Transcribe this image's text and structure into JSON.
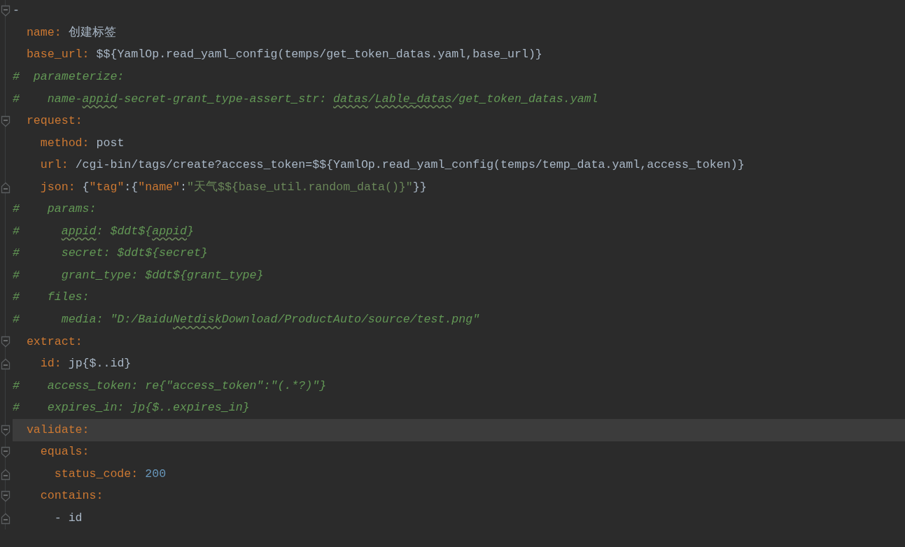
{
  "editor": {
    "lines": [
      {
        "kind": "fold_start",
        "current": false,
        "tokens": [
          {
            "kind": "plain",
            "text": "-"
          }
        ]
      },
      {
        "kind": "plain",
        "current": false,
        "tokens": [
          {
            "kind": "key",
            "text": "  name"
          },
          {
            "kind": "punct",
            "text": ": "
          },
          {
            "kind": "plain",
            "text": "创建标签"
          }
        ]
      },
      {
        "kind": "plain",
        "current": false,
        "tokens": [
          {
            "kind": "key",
            "text": "  base_url"
          },
          {
            "kind": "punct",
            "text": ": "
          },
          {
            "kind": "plain",
            "text": "$${YamlOp.read_yaml_config(temps/get_token_datas.yaml,base_url)}"
          }
        ]
      },
      {
        "kind": "plain",
        "current": false,
        "tokens": [
          {
            "kind": "comment",
            "text": "#  parameterize:"
          }
        ]
      },
      {
        "kind": "plain",
        "current": false,
        "tokens": [
          {
            "kind": "comment",
            "text": "#    name-"
          },
          {
            "kind": "comment",
            "text": "appid",
            "typo": true
          },
          {
            "kind": "comment",
            "text": "-secret-grant_type-assert_str: "
          },
          {
            "kind": "comment",
            "text": "datas",
            "typo": true
          },
          {
            "kind": "comment",
            "text": "/"
          },
          {
            "kind": "comment",
            "text": "Lable_datas",
            "typo": true
          },
          {
            "kind": "comment",
            "text": "/get_token_datas.yaml"
          }
        ]
      },
      {
        "kind": "fold_start",
        "current": false,
        "tokens": [
          {
            "kind": "key",
            "text": "  request"
          },
          {
            "kind": "punct",
            "text": ":"
          }
        ]
      },
      {
        "kind": "plain",
        "current": false,
        "tokens": [
          {
            "kind": "key",
            "text": "    method"
          },
          {
            "kind": "punct",
            "text": ": "
          },
          {
            "kind": "plain",
            "text": "post"
          }
        ]
      },
      {
        "kind": "plain",
        "current": false,
        "tokens": [
          {
            "kind": "key",
            "text": "    url"
          },
          {
            "kind": "punct",
            "text": ": "
          },
          {
            "kind": "plain",
            "text": "/cgi-bin/tags/create?access_token=$${YamlOp.read_yaml_config(temps/temp_data.yaml,access_token)}"
          }
        ]
      },
      {
        "kind": "fold_end",
        "current": false,
        "tokens": [
          {
            "kind": "key",
            "text": "    json"
          },
          {
            "kind": "punct",
            "text": ": "
          },
          {
            "kind": "plain",
            "text": "{"
          },
          {
            "kind": "key",
            "text": "\"tag\""
          },
          {
            "kind": "plain",
            "text": ":{"
          },
          {
            "kind": "key",
            "text": "\"name\""
          },
          {
            "kind": "plain",
            "text": ":"
          },
          {
            "kind": "string",
            "text": "\"天气$${base_util.random_data()}\""
          },
          {
            "kind": "plain",
            "text": "}}"
          }
        ]
      },
      {
        "kind": "plain",
        "current": false,
        "tokens": [
          {
            "kind": "comment",
            "text": "#    params:"
          }
        ]
      },
      {
        "kind": "plain",
        "current": false,
        "tokens": [
          {
            "kind": "comment",
            "text": "#      "
          },
          {
            "kind": "comment",
            "text": "appid",
            "typo": true
          },
          {
            "kind": "comment",
            "text": ": $ddt${"
          },
          {
            "kind": "comment",
            "text": "appid",
            "typo": true
          },
          {
            "kind": "comment",
            "text": "}"
          }
        ]
      },
      {
        "kind": "plain",
        "current": false,
        "tokens": [
          {
            "kind": "comment",
            "text": "#      secret: $ddt${secret}"
          }
        ]
      },
      {
        "kind": "plain",
        "current": false,
        "tokens": [
          {
            "kind": "comment",
            "text": "#      grant_type: $ddt${grant_type}"
          }
        ]
      },
      {
        "kind": "plain",
        "current": false,
        "tokens": [
          {
            "kind": "comment",
            "text": "#    files:"
          }
        ]
      },
      {
        "kind": "plain",
        "current": false,
        "tokens": [
          {
            "kind": "comment",
            "text": "#      media: \"D:/Baidu"
          },
          {
            "kind": "comment",
            "text": "Netdisk",
            "typo": true
          },
          {
            "kind": "comment",
            "text": "Download/ProductAuto/source/test.png\""
          }
        ]
      },
      {
        "kind": "fold_start",
        "current": false,
        "tokens": [
          {
            "kind": "key",
            "text": "  extract"
          },
          {
            "kind": "punct",
            "text": ":"
          }
        ]
      },
      {
        "kind": "fold_end",
        "current": false,
        "tokens": [
          {
            "kind": "key",
            "text": "    id"
          },
          {
            "kind": "punct",
            "text": ": "
          },
          {
            "kind": "plain",
            "text": "jp{$..id}"
          }
        ]
      },
      {
        "kind": "plain",
        "current": false,
        "tokens": [
          {
            "kind": "comment",
            "text": "#    access_token: re{\"access_token\":\"(.*?)\"}"
          }
        ]
      },
      {
        "kind": "plain",
        "current": false,
        "tokens": [
          {
            "kind": "comment",
            "text": "#    expires_in: jp{$..expires_in}"
          }
        ]
      },
      {
        "kind": "fold_start",
        "current": true,
        "tokens": [
          {
            "kind": "key",
            "text": "  validate"
          },
          {
            "kind": "punct",
            "text": ":"
          }
        ]
      },
      {
        "kind": "fold_start",
        "current": false,
        "tokens": [
          {
            "kind": "key",
            "text": "    equals"
          },
          {
            "kind": "punct",
            "text": ":"
          }
        ]
      },
      {
        "kind": "fold_end",
        "current": false,
        "tokens": [
          {
            "kind": "key",
            "text": "      status_code"
          },
          {
            "kind": "punct",
            "text": ": "
          },
          {
            "kind": "number",
            "text": "200"
          }
        ]
      },
      {
        "kind": "fold_start",
        "current": false,
        "tokens": [
          {
            "kind": "key",
            "text": "    contains"
          },
          {
            "kind": "punct",
            "text": ":"
          }
        ]
      },
      {
        "kind": "fold_end",
        "current": false,
        "tokens": [
          {
            "kind": "plain",
            "text": "      - id"
          }
        ]
      }
    ]
  }
}
